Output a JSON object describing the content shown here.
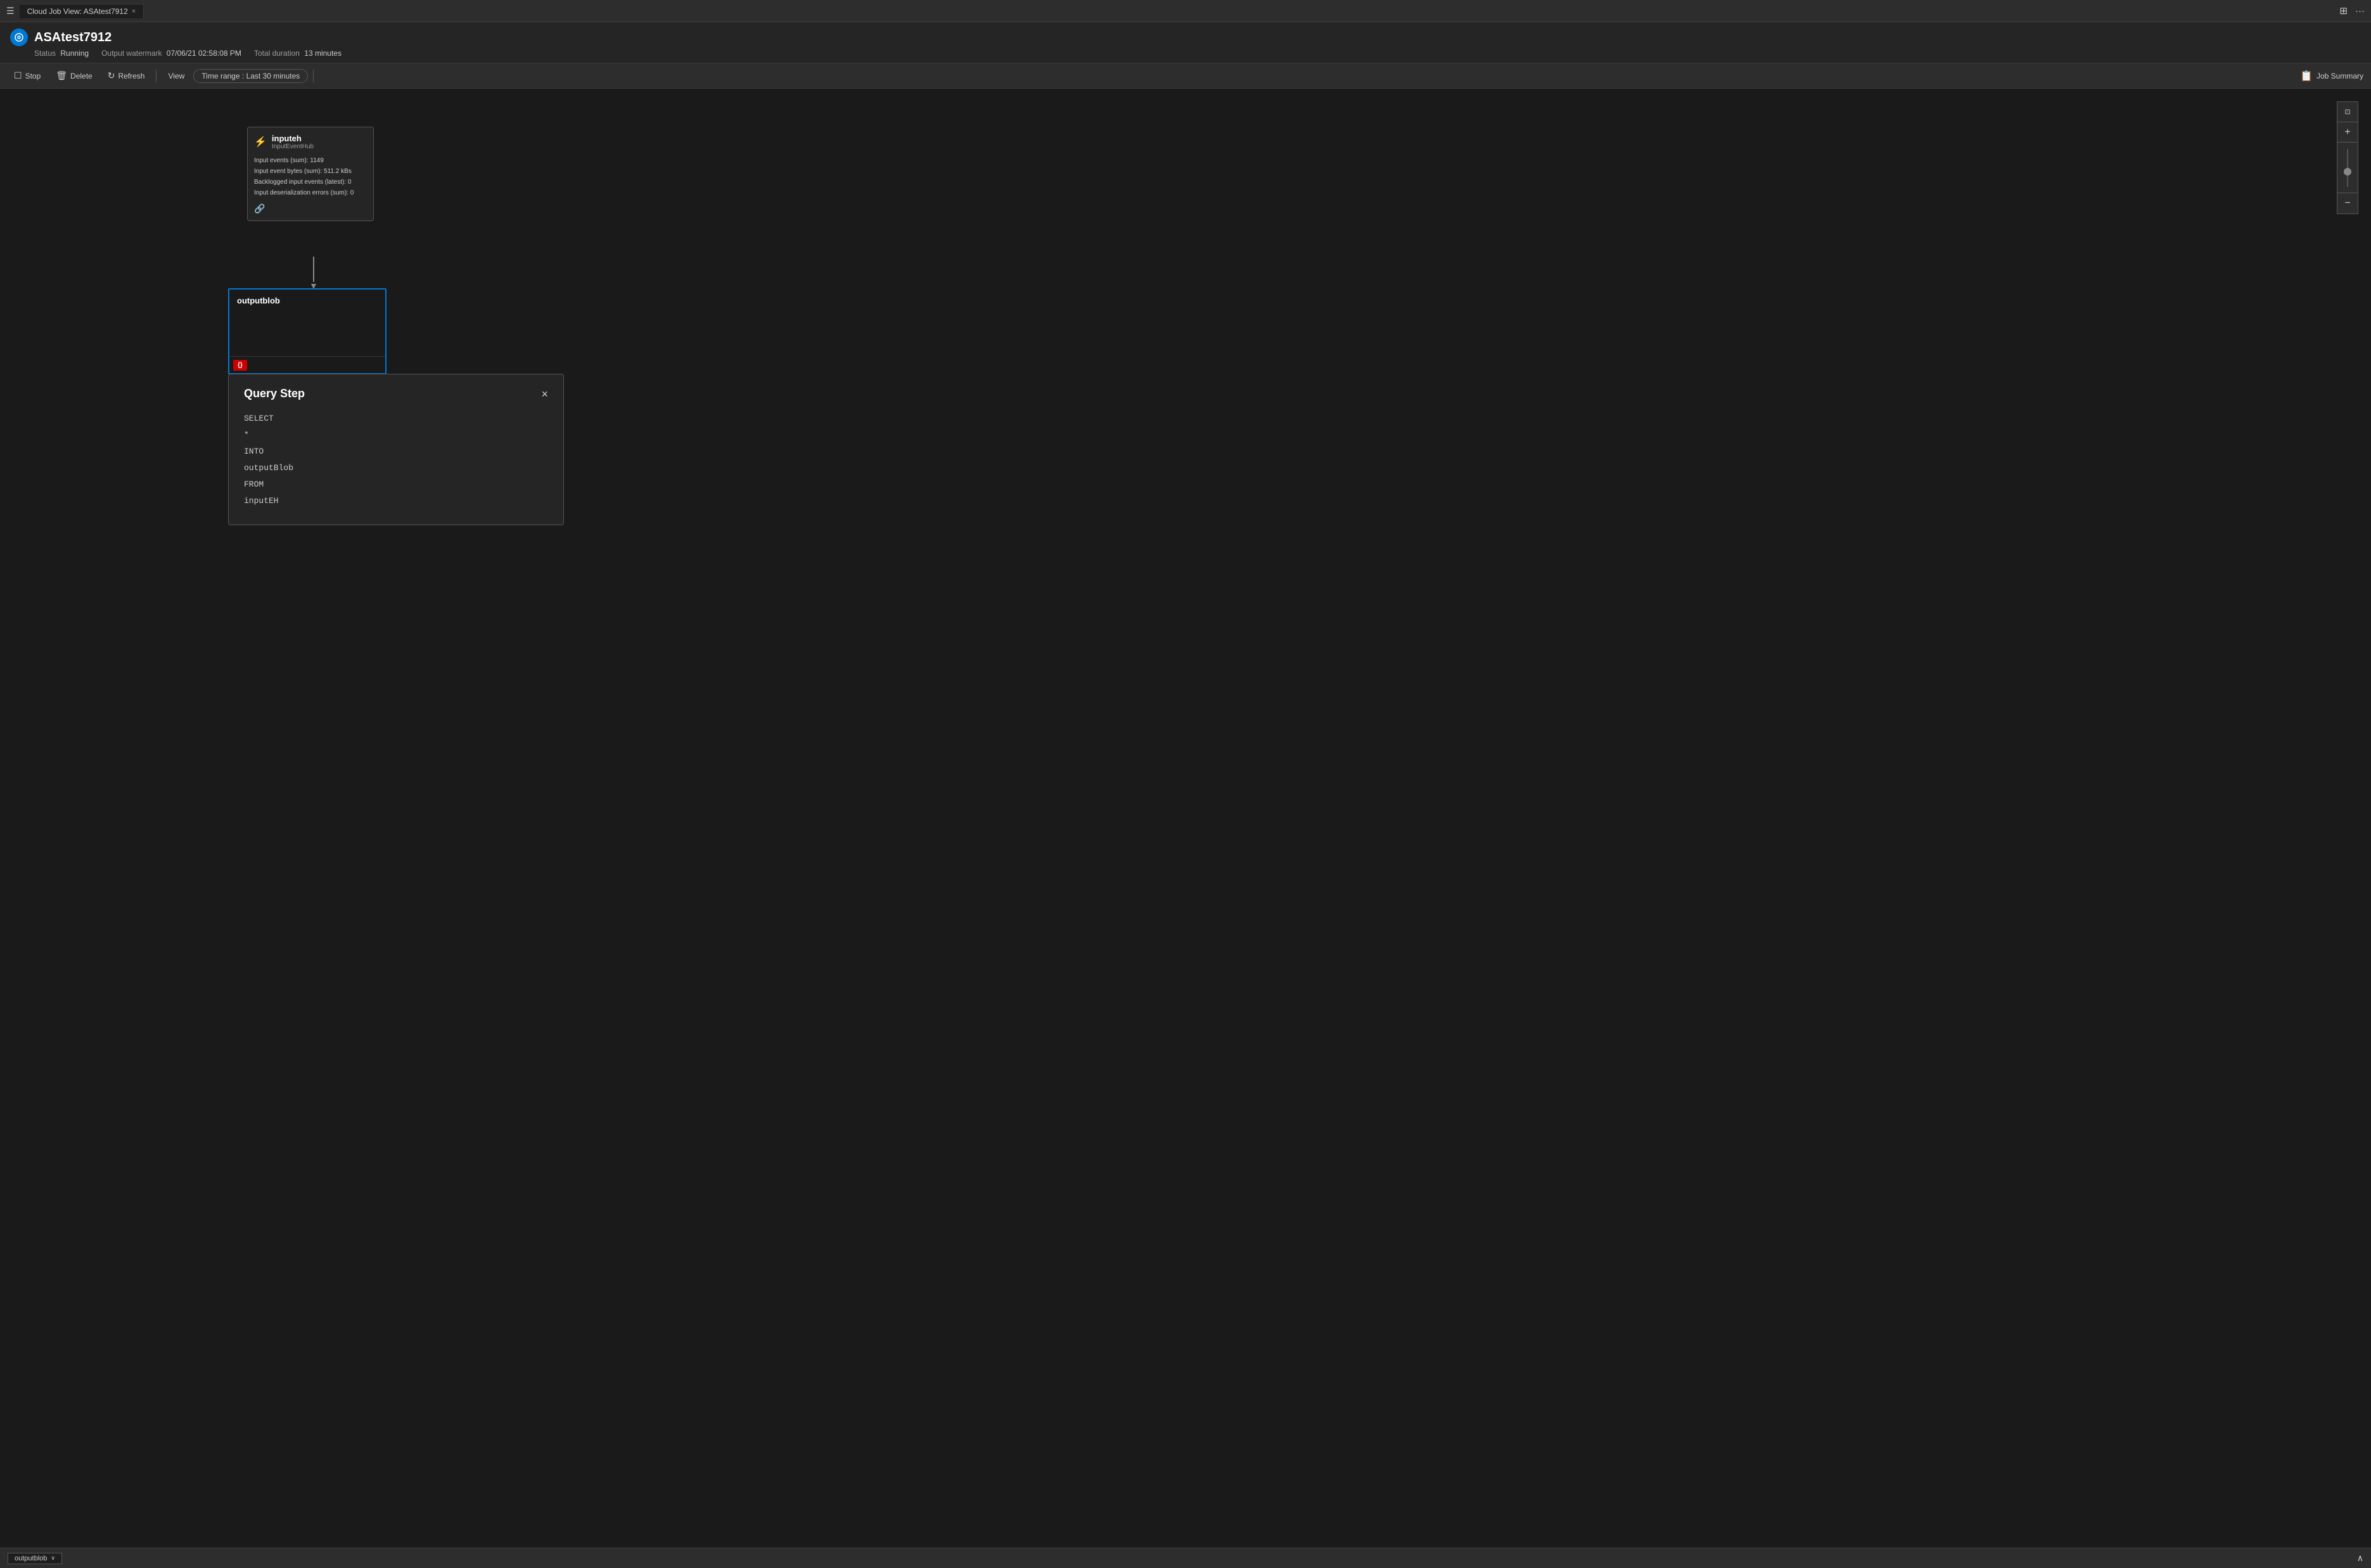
{
  "titleBar": {
    "tabLabel": "Cloud Job View: ASAtest7912",
    "tabClose": "×",
    "layoutIcon": "⊞",
    "moreIcon": "···"
  },
  "appHeader": {
    "iconText": "►",
    "title": "ASAtest7912",
    "statusLabel": "Status",
    "statusValue": "Running",
    "watermarkLabel": "Output watermark",
    "watermarkValue": "07/06/21 02:58:08 PM",
    "durationLabel": "Total duration",
    "durationValue": "13 minutes"
  },
  "toolbar": {
    "stopLabel": "Stop",
    "deleteLabel": "Delete",
    "refreshLabel": "Refresh",
    "viewLabel": "View",
    "timeRangeLabel": "Time range :  Last 30 minutes",
    "jobSummaryLabel": "Job Summary"
  },
  "canvas": {
    "inputNode": {
      "title": "inputeh",
      "subtitle": "InputEventHub",
      "stats": {
        "inputEvents": "Input events (sum): 1149",
        "inputBytes": "Input event bytes (sum): 511.2 kBs",
        "backloggedEvents": "Backlogged input events (latest): 0",
        "deserializationErrors": "Input deserialization errors (sum): 0"
      }
    },
    "outputNode": {
      "title": "outputblob"
    },
    "queryBadge": "{}"
  },
  "queryPopup": {
    "title": "Query Step",
    "closeLabel": "×",
    "codeLines": [
      "SELECT",
      "*",
      "INTO",
      "outputBlob",
      "FROM",
      "inputEH"
    ]
  },
  "bottomBar": {
    "tabLabel": "outputblob",
    "chevronDown": "∨",
    "chevronUp": "∧"
  },
  "zoom": {
    "fitIcon": "⊡",
    "plusIcon": "+",
    "minusIcon": "−"
  }
}
